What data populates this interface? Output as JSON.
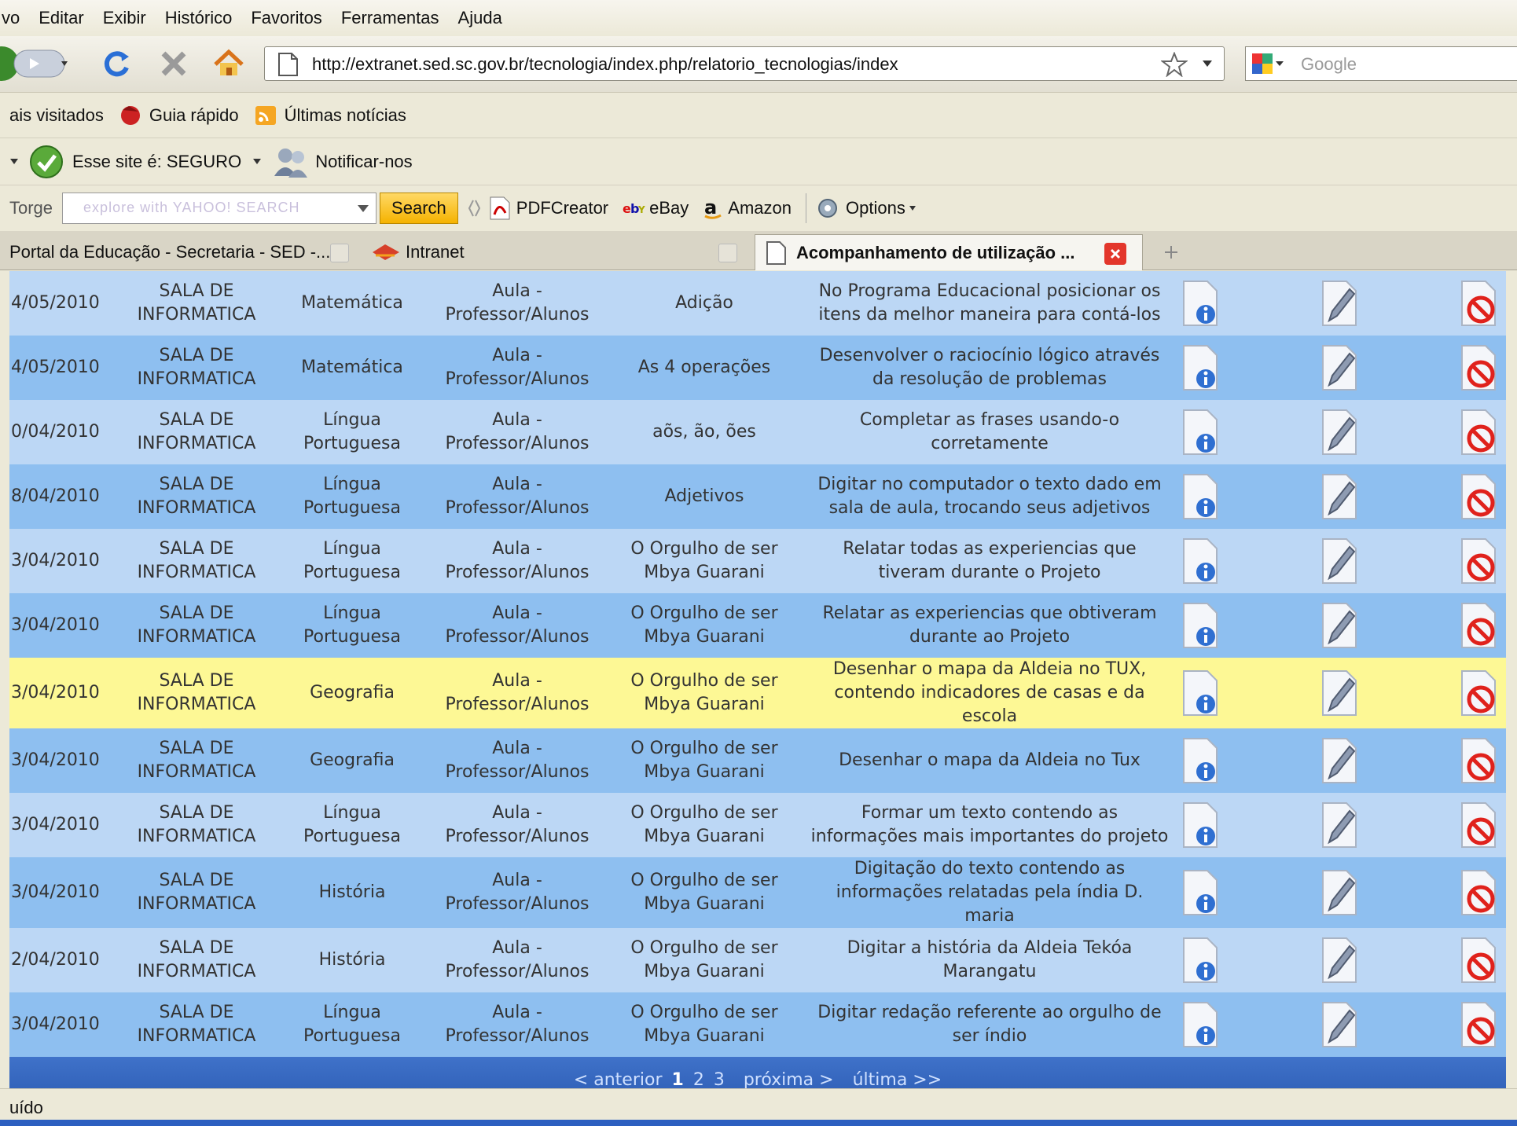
{
  "menu": [
    "vo",
    "Editar",
    "Exibir",
    "Histórico",
    "Favoritos",
    "Ferramentas",
    "Ajuda"
  ],
  "address": {
    "url": "http://extranet.sed.sc.gov.br/tecnologia/index.php/relatorio_tecnologias/index"
  },
  "search_engine": {
    "placeholder": "Google"
  },
  "bookmarks": [
    "ais visitados",
    "Guia rápido",
    "Últimas notícias"
  ],
  "security": {
    "status": "Esse site é: SEGURO",
    "notify": "Notificar-nos"
  },
  "yahoo": {
    "prefix": "Torge",
    "search_placeholder": "explore with YAHOO! SEARCH",
    "search_button": "Search",
    "items": [
      "PDFCreator",
      "eBay",
      "Amazon",
      "Options"
    ]
  },
  "tabs": [
    {
      "label": "Portal da Educação - Secretaria - SED -..."
    },
    {
      "label": "Intranet"
    },
    {
      "label": "Acompanhamento de utilização ..."
    }
  ],
  "rows": [
    {
      "date": "4/05/2010",
      "local": "SALA DE INFORMATICA",
      "disc": "Matemática",
      "type": "Aula - Professor/Alunos",
      "topic": "Adição",
      "desc": "No Programa Educacional posicionar os itens da melhor maneira para contá-los"
    },
    {
      "date": "4/05/2010",
      "local": "SALA DE INFORMATICA",
      "disc": "Matemática",
      "type": "Aula - Professor/Alunos",
      "topic": "As 4 operações",
      "desc": "Desenvolver o raciocínio lógico através da resolução de problemas"
    },
    {
      "date": "0/04/2010",
      "local": "SALA DE INFORMATICA",
      "disc": "Língua Portuguesa",
      "type": "Aula - Professor/Alunos",
      "topic": "aõs, ão, ões",
      "desc": "Completar as frases usando-o corretamente"
    },
    {
      "date": "8/04/2010",
      "local": "SALA DE INFORMATICA",
      "disc": "Língua Portuguesa",
      "type": "Aula - Professor/Alunos",
      "topic": "Adjetivos",
      "desc": "Digitar no computador o texto dado em sala de aula, trocando seus adjetivos"
    },
    {
      "date": "3/04/2010",
      "local": "SALA DE INFORMATICA",
      "disc": "Língua Portuguesa",
      "type": "Aula - Professor/Alunos",
      "topic": "O Orgulho de ser Mbya Guarani",
      "desc": "Relatar todas as experiencias que tiveram durante o Projeto"
    },
    {
      "date": "3/04/2010",
      "local": "SALA DE INFORMATICA",
      "disc": "Língua Portuguesa",
      "type": "Aula - Professor/Alunos",
      "topic": "O Orgulho de ser Mbya Guarani",
      "desc": "Relatar as experiencias que obtiveram durante ao Projeto"
    },
    {
      "date": "3/04/2010",
      "local": "SALA DE INFORMATICA",
      "disc": "Geografia",
      "type": "Aula - Professor/Alunos",
      "topic": "O Orgulho de ser Mbya Guarani",
      "desc": "Desenhar o mapa da Aldeia no TUX, contendo indicadores de casas e da escola"
    },
    {
      "date": "3/04/2010",
      "local": "SALA DE INFORMATICA",
      "disc": "Geografia",
      "type": "Aula - Professor/Alunos",
      "topic": "O Orgulho de ser Mbya Guarani",
      "desc": "Desenhar o mapa da Aldeia no Tux"
    },
    {
      "date": "3/04/2010",
      "local": "SALA DE INFORMATICA",
      "disc": "Língua Portuguesa",
      "type": "Aula - Professor/Alunos",
      "topic": "O Orgulho de ser Mbya Guarani",
      "desc": "Formar um texto contendo as informações mais importantes do projeto"
    },
    {
      "date": "3/04/2010",
      "local": "SALA DE INFORMATICA",
      "disc": "História",
      "type": "Aula - Professor/Alunos",
      "topic": "O Orgulho de ser Mbya Guarani",
      "desc": "Digitação do texto contendo as informações relatadas pela índia D. maria"
    },
    {
      "date": "2/04/2010",
      "local": "SALA DE INFORMATICA",
      "disc": "História",
      "type": "Aula - Professor/Alunos",
      "topic": "O Orgulho de ser Mbya Guarani",
      "desc": "Digitar a história da Aldeia Tekóa Marangatu"
    },
    {
      "date": "3/04/2010",
      "local": "SALA DE INFORMATICA",
      "disc": "Língua Portuguesa",
      "type": "Aula - Professor/Alunos",
      "topic": "O Orgulho de ser Mbya Guarani",
      "desc": "Digitar redação referente ao orgulho de ser índio"
    }
  ],
  "highlight_row": 6,
  "pager": {
    "prev": "< anterior",
    "pages": [
      "1",
      "2",
      "3"
    ],
    "current": "1",
    "next": "próxima >",
    "last": "última >>"
  },
  "status": "uído",
  "colors": {
    "row_light": "#bcd7f5",
    "row_dark": "#8ebff0",
    "row_highlight": "#fdf895",
    "pager": "#3f72c9"
  }
}
